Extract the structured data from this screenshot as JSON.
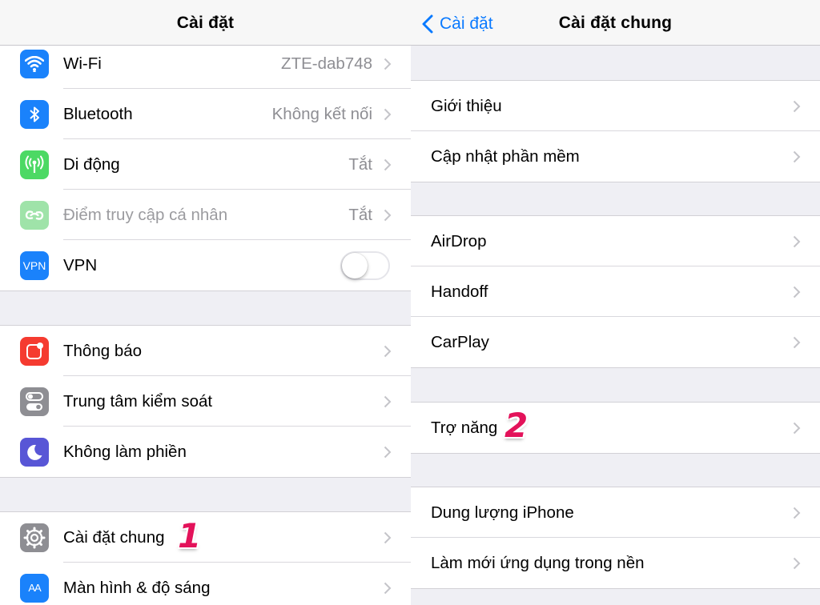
{
  "left": {
    "nav_title": "Cài đặt",
    "groups": [
      [
        {
          "label": "Wi-Fi",
          "value": "ZTE-dab748",
          "icon": "wifi-icon",
          "color": "#1a82fb"
        },
        {
          "label": "Bluetooth",
          "value": "Không kết nối",
          "icon": "bluetooth-icon",
          "color": "#1a82fb"
        },
        {
          "label": "Di động",
          "value": "Tắt",
          "icon": "cellular-icon",
          "color": "#4cd964"
        },
        {
          "label": "Điểm truy cập cá nhân",
          "value": "Tắt",
          "icon": "hotspot-icon",
          "color": "#9fe3a9"
        },
        {
          "label": "VPN",
          "icon_text": "VPN",
          "icon": "vpn-icon",
          "color": "#1a82fb",
          "toggle": "off"
        }
      ],
      [
        {
          "label": "Thông báo",
          "icon": "notifications-icon",
          "color": "#f53b30"
        },
        {
          "label": "Trung tâm kiểm soát",
          "icon": "control-center-icon",
          "color": "#8e8e93"
        },
        {
          "label": "Không làm phiền",
          "icon": "moon-icon",
          "color": "#5856d6"
        }
      ],
      [
        {
          "label": "Cài đặt chung",
          "icon": "gear-icon",
          "color": "#8e8e93",
          "step": "1"
        },
        {
          "label": "Màn hình & độ sáng",
          "icon_text": "AA",
          "icon": "display-brightness-icon",
          "color": "#1a82fb"
        }
      ]
    ]
  },
  "right": {
    "back_label": "Cài đặt",
    "nav_title": "Cài đặt chung",
    "groups": [
      [
        {
          "label": "Giới thiệu"
        },
        {
          "label": "Cập nhật phần mềm"
        }
      ],
      [
        {
          "label": "AirDrop"
        },
        {
          "label": "Handoff"
        },
        {
          "label": "CarPlay"
        }
      ],
      [
        {
          "label": "Trợ năng",
          "step": "2"
        }
      ],
      [
        {
          "label": "Dung lượng iPhone"
        },
        {
          "label": "Làm mới ứng dụng trong nền"
        }
      ]
    ]
  }
}
